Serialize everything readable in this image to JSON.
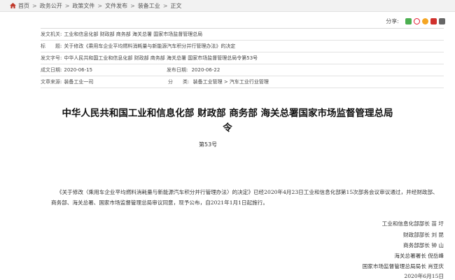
{
  "breadcrumb": {
    "items": [
      "首页",
      "政务公开",
      "政策文件",
      "文件发布",
      "装备工业",
      "正文"
    ],
    "separator": ">"
  },
  "share": {
    "label": "分享:",
    "icons": [
      "wechat-icon",
      "weibo-icon",
      "qzone-icon",
      "pdf-icon",
      "print-icon"
    ]
  },
  "meta": {
    "issuer": {
      "label": "发文机关:",
      "value": "工业和信息化部 财政部 商务部 海关总署 国家市场监督管理总局"
    },
    "subject": {
      "label": "标　　题:",
      "value": "关于修改《乘用车企业平均燃料消耗量与新能源汽车积分并行管理办法》的决定"
    },
    "doc_number": {
      "label": "发文字号:",
      "value": "中华人民共和国工业和信息化部 财政部 商务部 海关总署 国家市场监督管理总局令第53号"
    },
    "date_created": {
      "label": "成文日期:",
      "value": "2020-06-15"
    },
    "date_published": {
      "label": "发布日期:",
      "value": "2020-06-22"
    },
    "source": {
      "label": "文章来源:",
      "value": "装备工业一司"
    },
    "category": {
      "label": "分　　类:",
      "value": "装备工业管理 > 汽车工业行业管理"
    }
  },
  "document": {
    "title_line1": "中华人民共和国工业和信息化部 财政部 商务部 海关总署国家市场监督管理总局",
    "title_line2": "令",
    "number": "第53号",
    "body": "《关于修改〈乘用车企业平均燃料消耗量与新能源汽车积分并行管理办法〉的决定》已经2020年4月23日工业和信息化部第15次部务会议审议通过，并经财政部、商务部、海关总署、国家市场监督管理总局审议同意，现予公布，自2021年1月1日起施行。",
    "signatures": [
      "工业和信息化部部长 苗 圩",
      "财政部部长 刘 昆",
      "商务部部长 钟 山",
      "海关总署署长 倪岳峰",
      "国家市场监督管理总局局长 肖亚庆",
      "2020年6月15日"
    ]
  },
  "colors": {
    "accent": "#c0392b",
    "wechat": "#4caf50",
    "weibo": "#e6162d",
    "qzone": "#f5a623",
    "pdf": "#d0312d"
  }
}
